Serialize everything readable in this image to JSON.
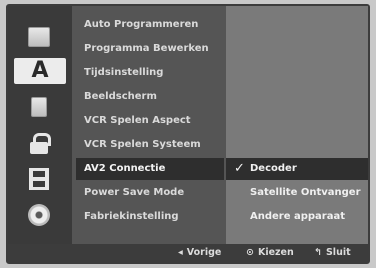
{
  "sidebar": {
    "icons": [
      {
        "name": "disc-menu-icon",
        "glyph": ""
      },
      {
        "name": "language-icon",
        "glyph": "A"
      },
      {
        "name": "audio-icon",
        "glyph": ""
      },
      {
        "name": "lock-icon",
        "glyph": ""
      },
      {
        "name": "record-icon",
        "glyph": ""
      },
      {
        "name": "disc-icon",
        "glyph": ""
      }
    ]
  },
  "menu": {
    "items": [
      "Auto Programmeren",
      "Programma Bewerken",
      "Tijdsinstelling",
      "Beeldscherm",
      "VCR Spelen Aspect",
      "VCR Spelen Systeem",
      "AV2 Connectie",
      "Power Save Mode",
      "Fabriekinstelling"
    ],
    "selected_index": 6
  },
  "submenu": {
    "items": [
      "Decoder",
      "Satellite Ontvanger",
      "Andere apparaat"
    ],
    "selected_index": 0,
    "check": "✓"
  },
  "footer": {
    "prev": {
      "glyph": "◂",
      "label": "Vorige"
    },
    "select": {
      "glyph": "⊙",
      "label": "Kiezen"
    },
    "close": {
      "glyph": "↰",
      "label": "Sluit"
    }
  }
}
